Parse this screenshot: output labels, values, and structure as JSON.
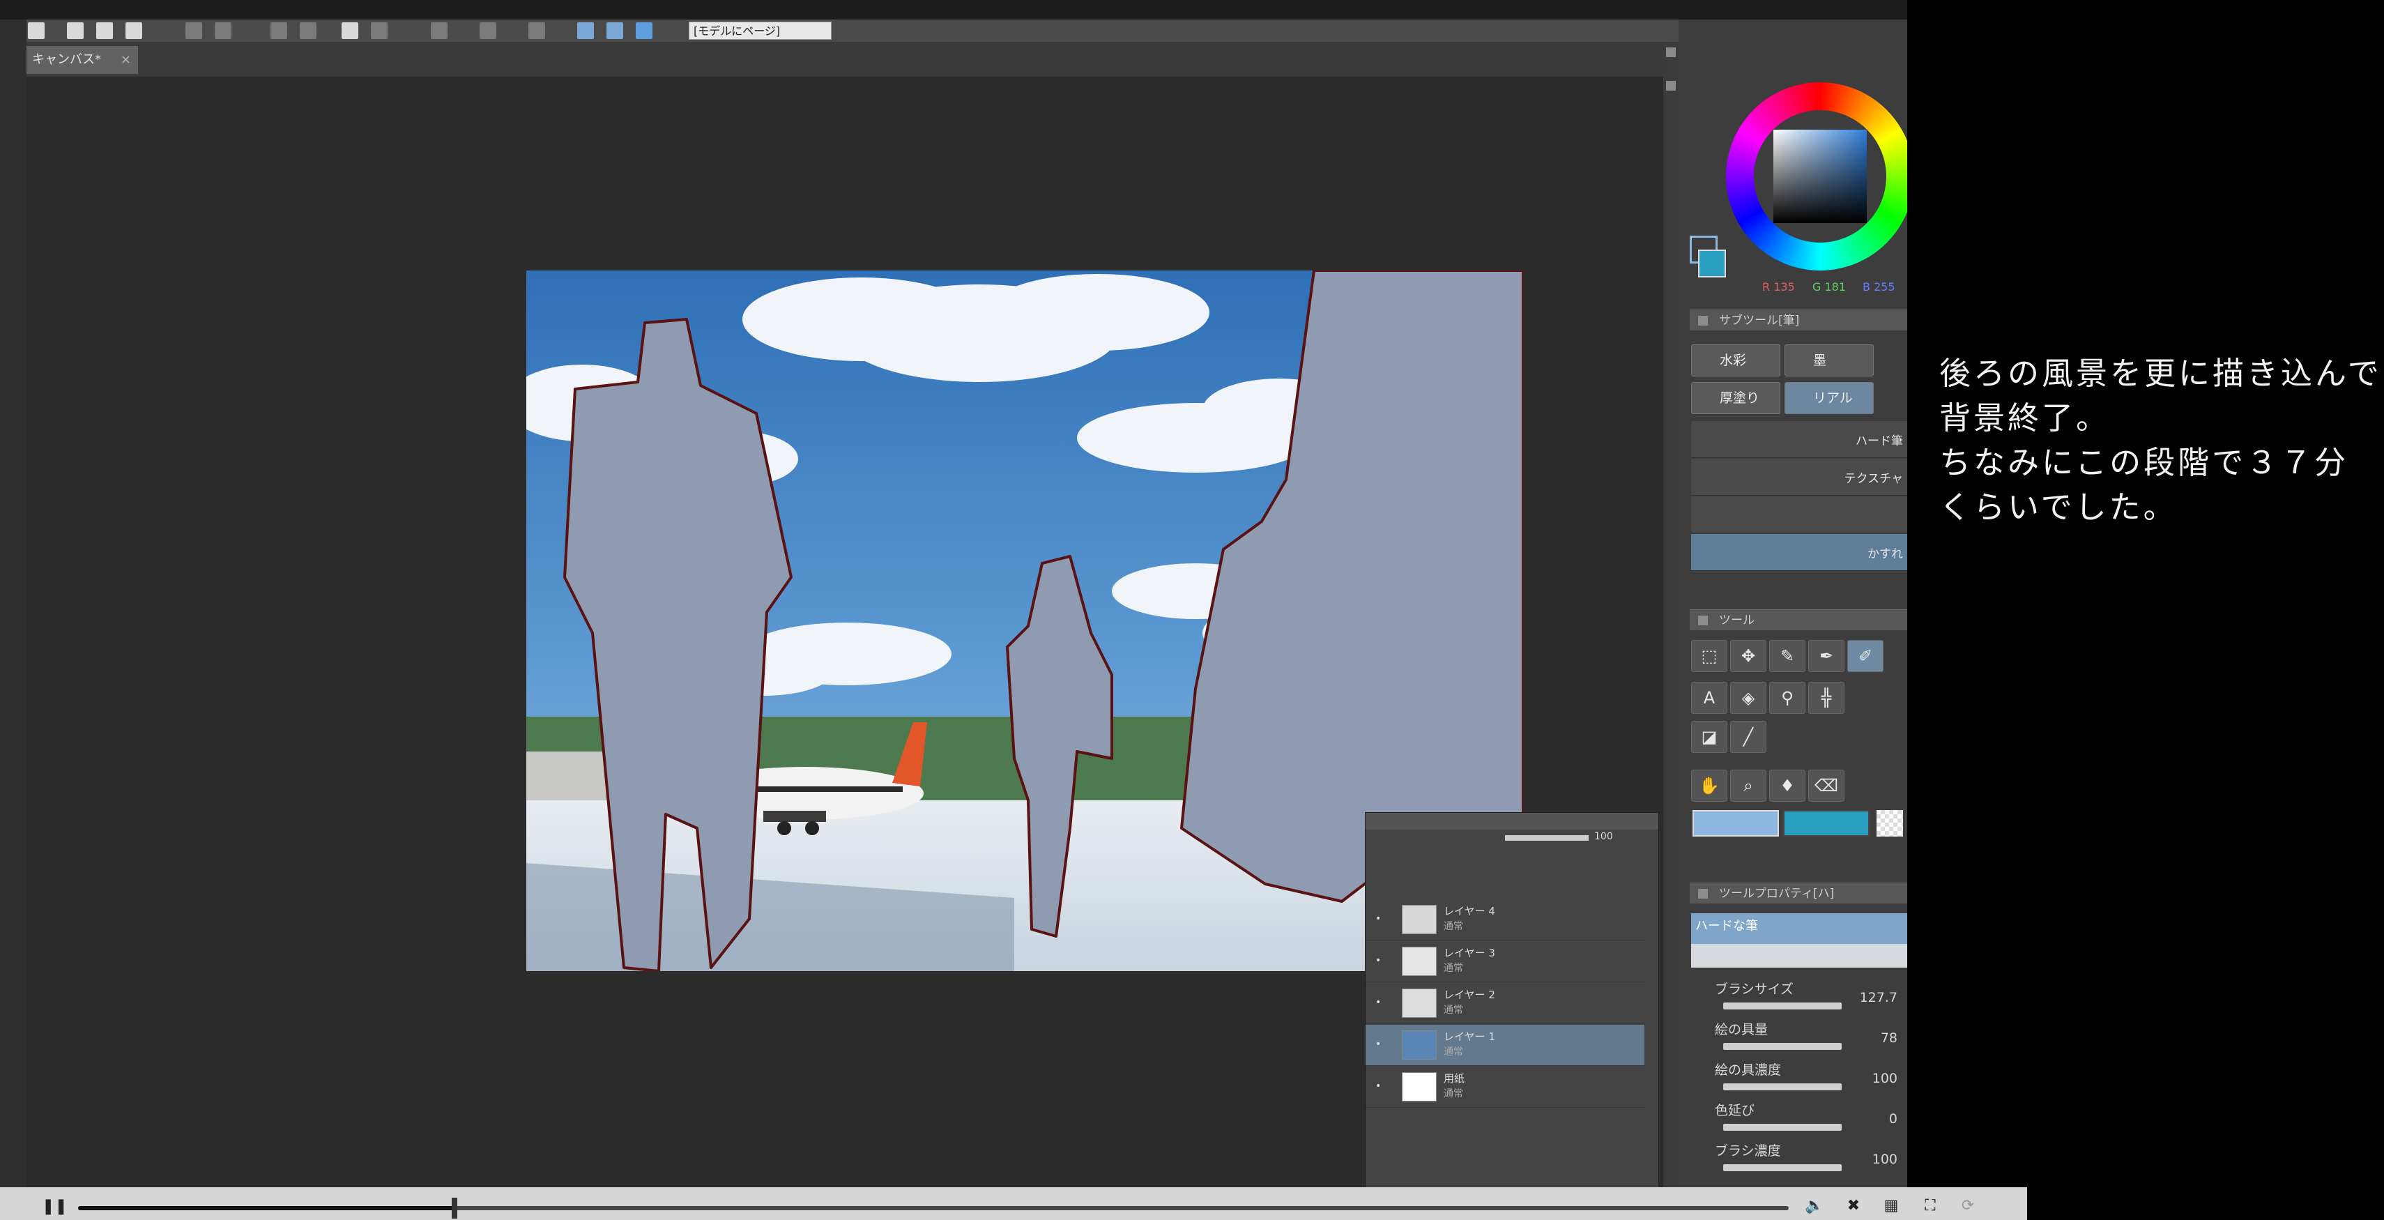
{
  "app": {
    "toolbar_field": "[モデルにページ]",
    "document_tab": "キャンバス*",
    "document_tab_close": "×"
  },
  "panel": {
    "color_readout": {
      "r": "R 135",
      "g": "G 181",
      "b": "B 255"
    },
    "subtool_header": "サブツール[筆]",
    "subtool_buttons": [
      "水彩",
      "墨",
      "厚塗り",
      "リアル"
    ],
    "brushes": [
      "ハード筆",
      "テクスチャ",
      "",
      "かすれ"
    ],
    "tool_header": "ツール",
    "tool_property_header": "ツールプロパティ[ハ]",
    "tool_property_title": "ハードな筆",
    "properties": [
      {
        "label": "ブラシサイズ",
        "value": "127.7"
      },
      {
        "label": "絵の具量",
        "value": "78"
      },
      {
        "label": "絵の具濃度",
        "value": "100"
      },
      {
        "label": "色延び",
        "value": "0"
      },
      {
        "label": "ブラシ濃度",
        "value": "100"
      }
    ],
    "main_color": "#2a9fc0",
    "sub_color": "#8fb8e0"
  },
  "layers": {
    "opacity": "100",
    "items": [
      {
        "name": "レイヤー 4",
        "mode": "通常",
        "thumb": "#d8d8d8"
      },
      {
        "name": "レイヤー 3",
        "mode": "通常",
        "thumb": "#e5e5e5"
      },
      {
        "name": "レイヤー 2",
        "mode": "通常",
        "thumb": "#dcdcdc"
      },
      {
        "name": "レイヤー 1",
        "mode": "通常",
        "thumb": "#5b86b8"
      },
      {
        "name": "用紙",
        "mode": "通常",
        "thumb": "#ffffff"
      }
    ]
  },
  "caption": {
    "lines": [
      "後ろの風景を更に描き込んで",
      "背景終了。",
      "ちなみにこの段階で３７分",
      "くらいでした。"
    ]
  },
  "player": {
    "play_icon": "pause-icon",
    "progress": 0.22
  }
}
